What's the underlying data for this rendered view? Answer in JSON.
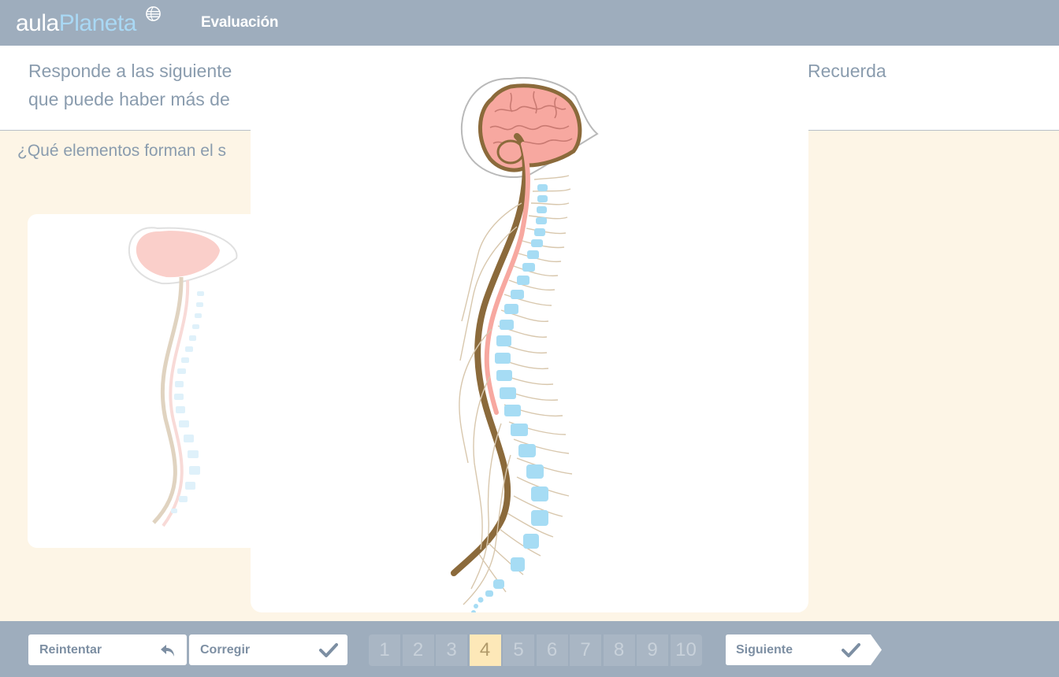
{
  "header": {
    "logo_part1": "aula",
    "logo_part2": "Planeta",
    "title": "Evaluación"
  },
  "instructions": {
    "line1_start": "Responde a las siguiente",
    "line1_end": "Recuerda",
    "line2_start": "que puede haber más de"
  },
  "question": {
    "text": "¿Qué elementos forman el s"
  },
  "footer": {
    "retry_label": "Reintentar",
    "check_label": "Corregir",
    "next_label": "Siguiente",
    "pages": [
      "1",
      "2",
      "3",
      "4",
      "5",
      "6",
      "7",
      "8",
      "9",
      "10"
    ],
    "current_page": "4"
  },
  "colors": {
    "header_bg": "#9eadbd",
    "page_bg": "#fdf5e6",
    "brain": "#f7a8a0",
    "spinal_cord": "#8b6a3b",
    "vertebrae": "#a6dcf4",
    "nerves": "#d8c7ad",
    "active_page": "#fde8b8"
  }
}
